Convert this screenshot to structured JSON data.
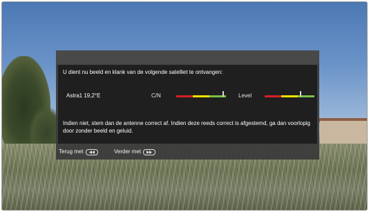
{
  "dialog": {
    "intro": "U dient nu beeld en klank van de volgende satelliet te ontvangen:",
    "satellite": "Astra1 19,2°E",
    "cn_label": "C/N",
    "level_label": "Level",
    "cn_value": 0.94,
    "level_value": 0.72,
    "meter_colors": {
      "low": "#d81f26",
      "mid": "#f4e400",
      "high": "#7cc144"
    },
    "note": "Indien niet, stem dan de antenne correct af. Indien deze reeds correct is afgestemd, ga dan voorlopig door zonder beeld en geluid."
  },
  "footer": {
    "back_label": "Terug met",
    "back_icon": "rewind-icon",
    "forward_label": "Verder met",
    "forward_icon": "fast-forward-icon"
  }
}
